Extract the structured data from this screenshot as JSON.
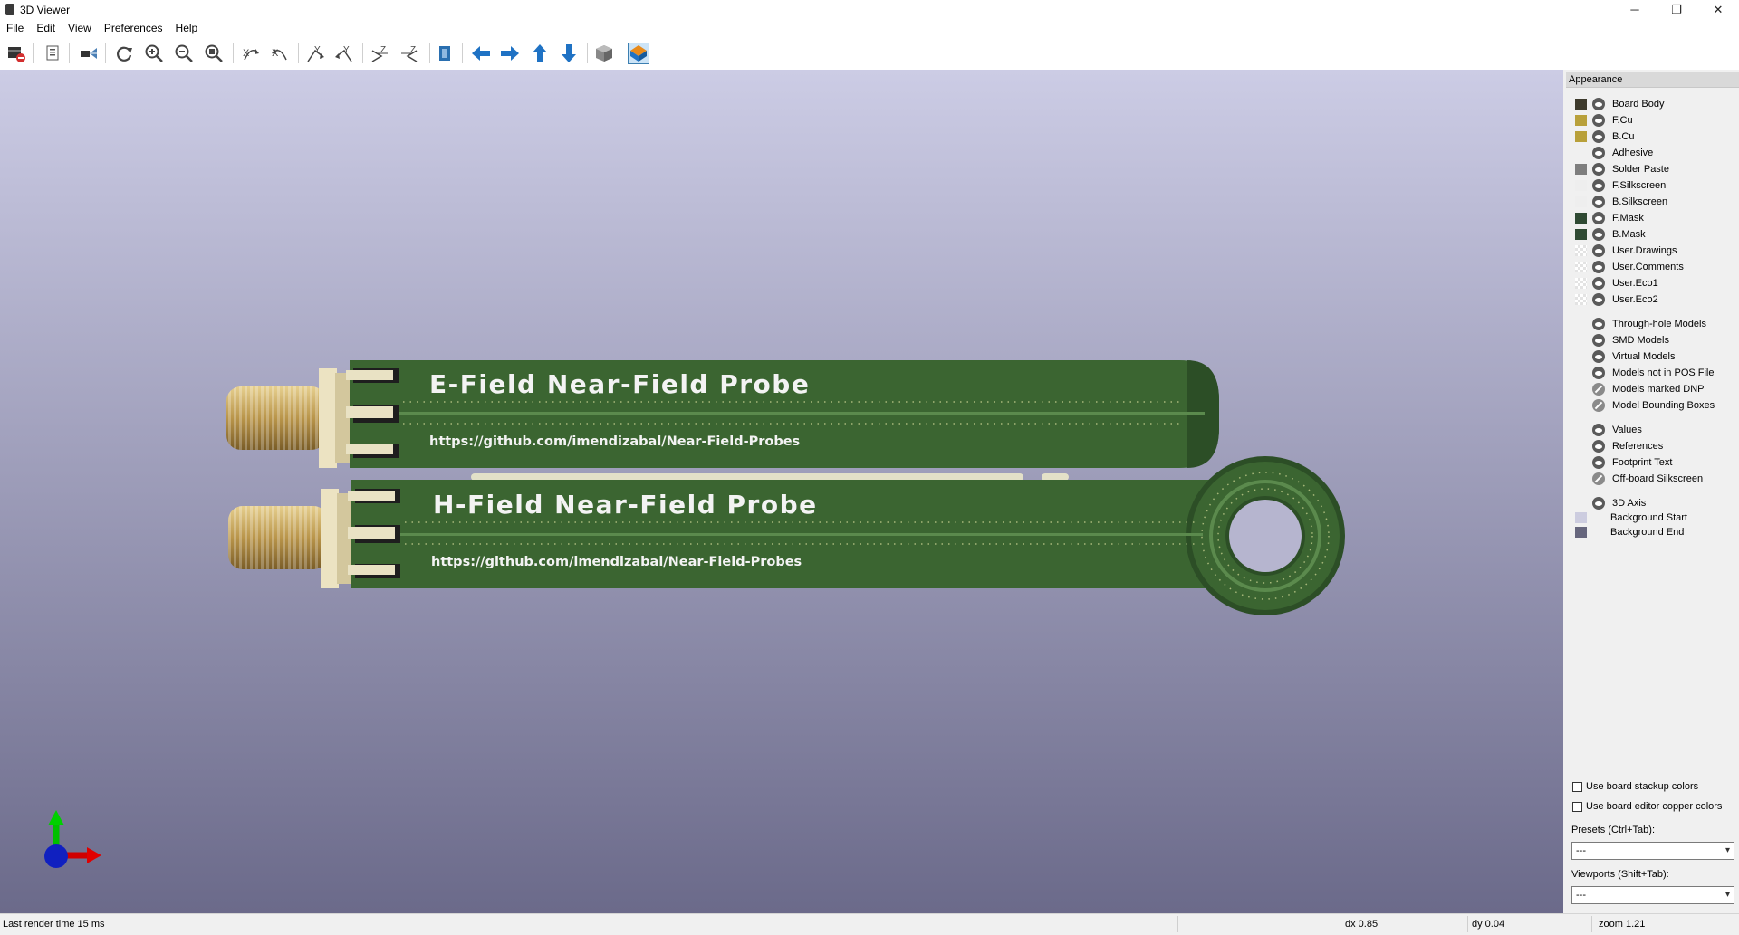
{
  "window": {
    "title": "3D Viewer",
    "minimize": "─",
    "maximize": "❐",
    "close": "✕"
  },
  "menu": [
    "File",
    "Edit",
    "View",
    "Preferences",
    "Help"
  ],
  "toolbar": {
    "icons": [
      "render-icon",
      "copy-image-icon",
      "raytrace-icon",
      "reload-icon",
      "zoom-in-icon",
      "zoom-out-icon",
      "zoom-fit-icon",
      "rotate-x-cw-icon",
      "rotate-x-ccw-icon",
      "rotate-y-cw-icon",
      "rotate-y-ccw-icon",
      "rotate-z-cw-icon",
      "rotate-z-ccw-icon",
      "flip-board-icon",
      "pan-left-icon",
      "pan-right-icon",
      "pan-up-icon",
      "pan-down-icon",
      "orthographic-icon",
      "perspective-toggle-icon"
    ]
  },
  "board": {
    "e_probe_title": "E-Field Near-Field Probe",
    "e_probe_url": "https://github.com/imendizabal/Near-Field-Probes",
    "h_probe_title": "H-Field Near-Field Probe",
    "h_probe_url": "https://github.com/imendizabal/Near-Field-Probes"
  },
  "appearance": {
    "title": "Appearance",
    "layers": [
      {
        "label": "Board Body",
        "color": "#3d3a2c",
        "eye": "on"
      },
      {
        "label": "F.Cu",
        "color": "#b8a03a",
        "eye": "on"
      },
      {
        "label": "B.Cu",
        "color": "#b8a03a",
        "eye": "on"
      },
      {
        "label": "Adhesive",
        "color": "",
        "eye": "on"
      },
      {
        "label": "Solder Paste",
        "color": "#7e7e7e",
        "eye": "on"
      },
      {
        "label": "F.Silkscreen",
        "color": "#eeeeee",
        "eye": "on"
      },
      {
        "label": "B.Silkscreen",
        "color": "#eeeeee",
        "eye": "on"
      },
      {
        "label": "F.Mask",
        "color": "#2f4a33",
        "eye": "on"
      },
      {
        "label": "B.Mask",
        "color": "#2f4a33",
        "eye": "on"
      },
      {
        "label": "User.Drawings",
        "color": "checker",
        "eye": "on"
      },
      {
        "label": "User.Comments",
        "color": "checker",
        "eye": "on"
      },
      {
        "label": "User.Eco1",
        "color": "checker",
        "eye": "on"
      },
      {
        "label": "User.Eco2",
        "color": "checker",
        "eye": "on"
      }
    ],
    "models": [
      {
        "label": "Through-hole Models",
        "eye": "on"
      },
      {
        "label": "SMD Models",
        "eye": "on"
      },
      {
        "label": "Virtual Models",
        "eye": "on"
      },
      {
        "label": "Models not in POS File",
        "eye": "on"
      },
      {
        "label": "Models marked DNP",
        "eye": "off"
      },
      {
        "label": "Model Bounding Boxes",
        "eye": "off"
      }
    ],
    "text_items": [
      {
        "label": "Values",
        "eye": "on"
      },
      {
        "label": "References",
        "eye": "on"
      },
      {
        "label": "Footprint Text",
        "eye": "on"
      },
      {
        "label": "Off-board Silkscreen",
        "eye": "off"
      }
    ],
    "misc": [
      {
        "label": "3D Axis",
        "eye": "on",
        "color": ""
      },
      {
        "label": "Background Start",
        "eye": "",
        "color": "#ccccdf"
      },
      {
        "label": "Background End",
        "eye": "",
        "color": "#66667d"
      }
    ],
    "use_board_stackup_colors": "Use board stackup colors",
    "use_board_editor_copper_colors": "Use board editor copper colors",
    "presets_label": "Presets (Ctrl+Tab):",
    "presets_value": "---",
    "viewports_label": "Viewports (Shift+Tab):",
    "viewports_value": "---"
  },
  "status": {
    "render_time": "Last render time 15 ms",
    "dx": "dx 0.85",
    "dy": "dy 0.04",
    "zoom": "zoom 1.21"
  }
}
